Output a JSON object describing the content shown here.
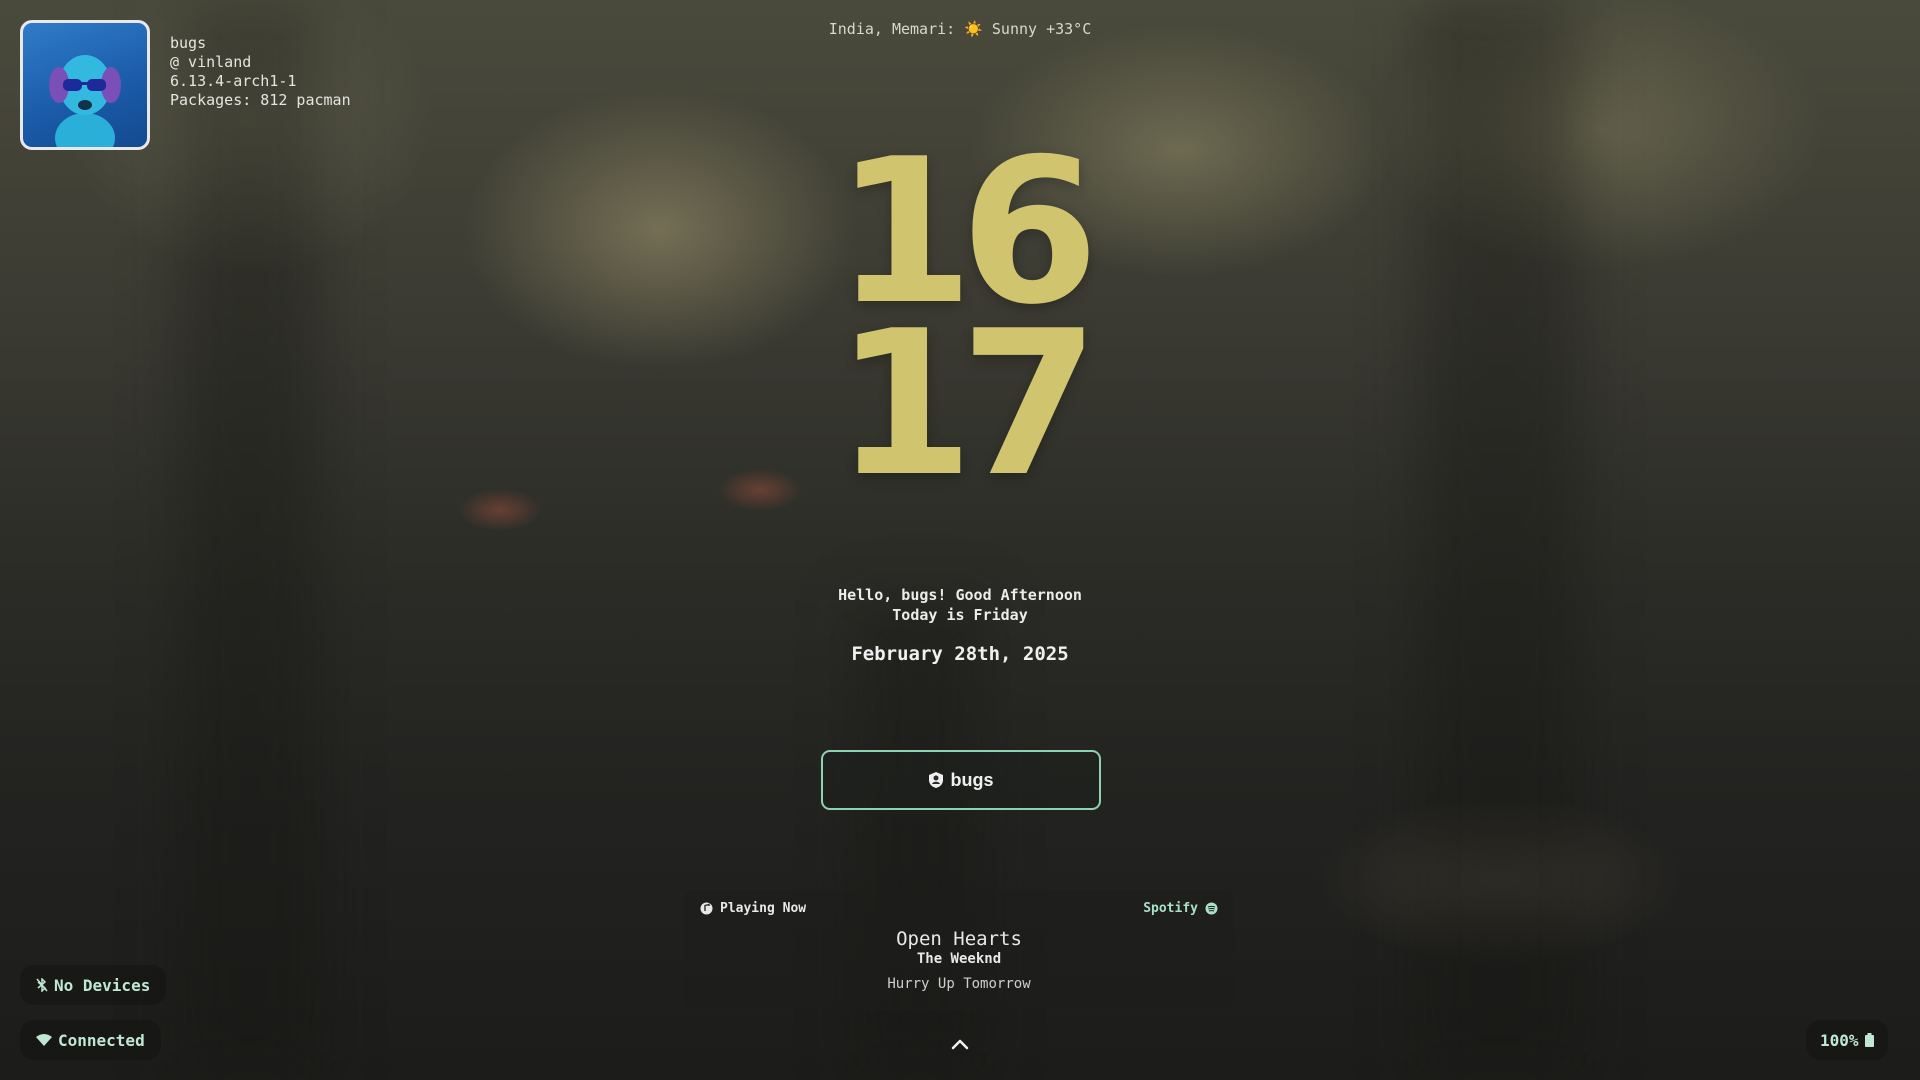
{
  "user": {
    "name": "bugs",
    "host": "@ vinland",
    "kernel": "6.13.4-arch1-1",
    "packages": "Packages: 812 pacman"
  },
  "weather": "India, Memari: ☀️   Sunny +33°C",
  "clock": {
    "hours": "16",
    "minutes": "17"
  },
  "greeting": {
    "line1": "Hello, bugs! Good Afternoon",
    "line2": "Today is Friday"
  },
  "date": "February 28th, 2025",
  "login": {
    "user": "bugs"
  },
  "player": {
    "status": "Playing Now",
    "source": "Spotify",
    "title": "Open Hearts",
    "artist": "The Weeknd",
    "album": "Hurry Up Tomorrow"
  },
  "bluetooth": "No Devices",
  "network": "Connected",
  "battery": "100%",
  "colors": {
    "accent": "#d1c46f",
    "mint": "#8fd1b0"
  },
  "icons": [
    "bluetooth-off-icon",
    "wifi-icon",
    "battery-icon",
    "user-shield-icon",
    "music-disc-icon",
    "spotify-icon",
    "chevron-up-icon"
  ]
}
